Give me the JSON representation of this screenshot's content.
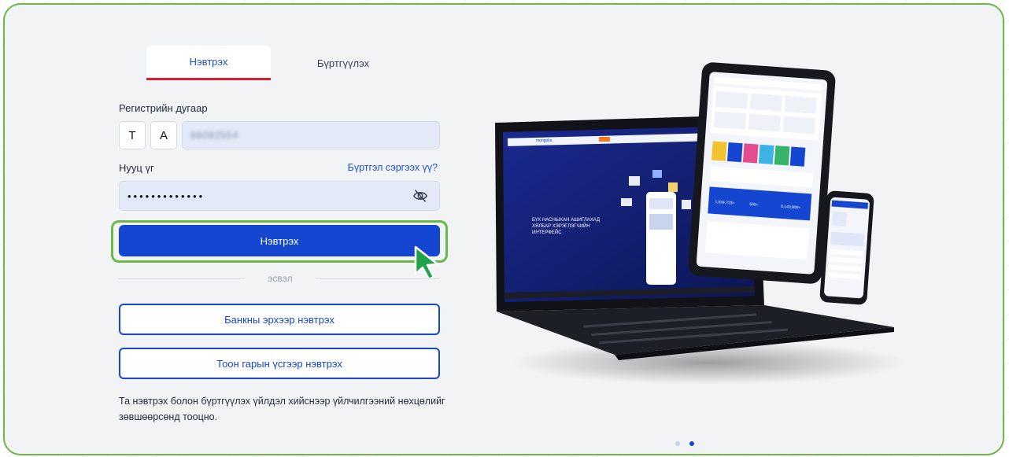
{
  "tabs": {
    "login": "Нэвтрэх",
    "register": "Бүртгүүлэх"
  },
  "form": {
    "registration_label": "Регистрийн дугаар",
    "letter1": "Т",
    "letter2": "А",
    "registration_value": "98092554",
    "password_label": "Нууц үг",
    "forgot_link": "Бүртгэл сэргээх үү?",
    "password_value": "•••••••••••••"
  },
  "buttons": {
    "login": "Нэвтрэх",
    "or": "эсвэл",
    "bank_login": "Банкны эрхээр нэвтрэх",
    "signature_login": "Тоон гарын үсгээр нэвтрэх"
  },
  "terms_text": "Та нэвтрэх болон бүртгүүлэх үйлдэл хийснээр үйлчилгээний нөхцөлийг зөвшөөрсөнд тооцно.",
  "illustration": {
    "brand": "mongolia",
    "headline_lines": [
      "БҮХ НАСНЫХАН АШИГЛАХАД",
      "ХЯЛБАР ХЭРЭГЛЭГЧИЙН",
      "ИНТЕРФЕЙС"
    ],
    "stats": [
      "1,534,723+",
      "500+",
      "6,143,809+"
    ]
  },
  "carousel": {
    "total": 2,
    "active_index": 1
  },
  "colors": {
    "primary": "#1546d1",
    "accent_red": "#d91f32",
    "highlight_green": "#6bb84a"
  }
}
